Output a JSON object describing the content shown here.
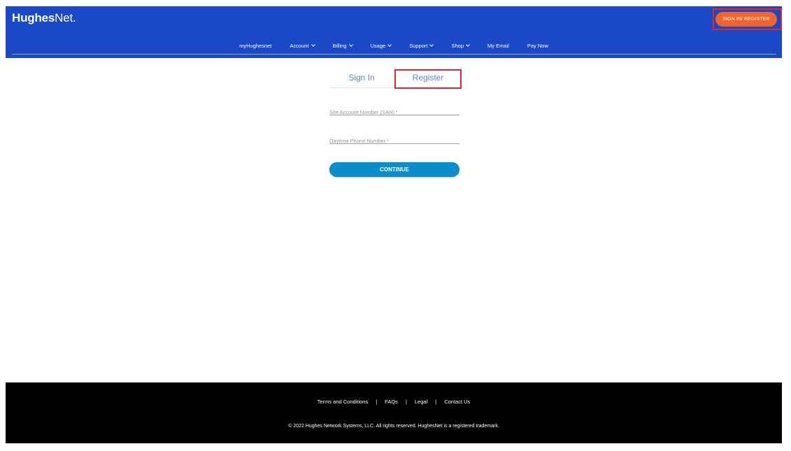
{
  "brand": {
    "name_bold": "Hughes",
    "name_light": "Net",
    "suffix": "."
  },
  "header": {
    "signin_label": "SIGN IN/ REGISTER",
    "nav": [
      {
        "label": "myHughesnet",
        "dropdown": false
      },
      {
        "label": "Account",
        "dropdown": true
      },
      {
        "label": "Billing",
        "dropdown": true
      },
      {
        "label": "Usage",
        "dropdown": true
      },
      {
        "label": "Support",
        "dropdown": true
      },
      {
        "label": "Shop",
        "dropdown": true
      },
      {
        "label": "My Email",
        "dropdown": false
      },
      {
        "label": "Pay Now",
        "dropdown": false
      }
    ]
  },
  "tabs": {
    "signin": "Sign In",
    "register": "Register"
  },
  "form": {
    "san_placeholder": "Site Account Number (SAN) *",
    "phone_placeholder": "Daytime Phone Number *",
    "continue_label": "CONTINUE"
  },
  "footer": {
    "links": [
      "Terms and Conditions",
      "FAQs",
      "Legal",
      "Contact Us"
    ],
    "copyright": "© 2022 Hughes Network Systems, LLC. All rights reserved. HughesNet is a registered trademark."
  },
  "colors": {
    "header_bg": "#1b48c7",
    "signin_btn": "#f2642a",
    "continue_btn": "#0a8ecb",
    "highlight_box": "#e3262f",
    "footer_bg": "#000000"
  }
}
